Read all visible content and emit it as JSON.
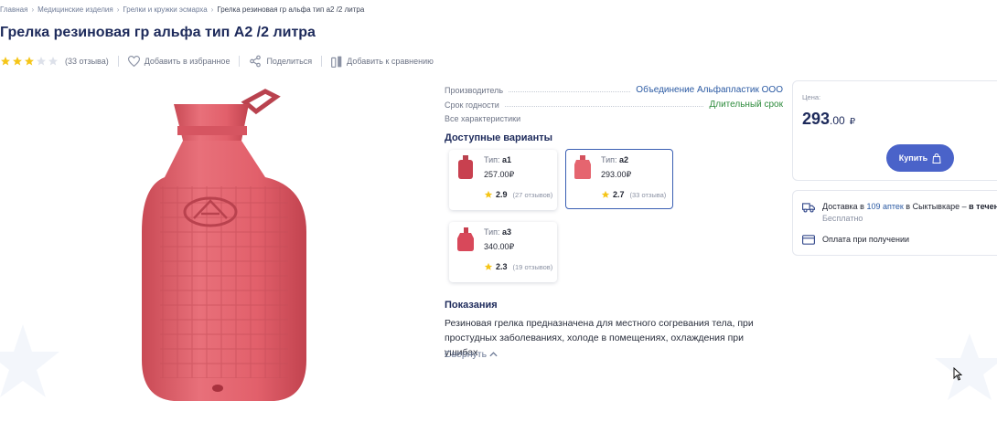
{
  "breadcrumb": {
    "items": [
      "Главная",
      "Медицинские изделия",
      "Грелки и кружки эсмарха"
    ],
    "current": "Грелка резиновая гр альфа тип а2 /2 литра"
  },
  "product": {
    "title": "Грелка резиновая гр альфа тип А2 /2 литра",
    "rating_stars": 3,
    "reviews_count": "(33 отзыва)",
    "favorite_label": "Добавить в избранное",
    "share_label": "Поделиться",
    "compare_label": "Добавить к сравнению",
    "image_icon": "hot-water-bottle-image"
  },
  "specs": [
    {
      "label": "Производитель",
      "value": "Объединение Альфапластик ООО",
      "color": "#2b5aa3"
    },
    {
      "label": "Срок годности",
      "value": "Длительный срок",
      "color": "#2d8b3c"
    }
  ],
  "all_specs_label": "Все характеристики",
  "variants": {
    "title": "Доступные варианты",
    "type_prefix": "Тип:",
    "items": [
      {
        "type": "а1",
        "price": "257.00₽",
        "rating": "2.9",
        "reviews": "(27 отзывов)",
        "active": false
      },
      {
        "type": "а2",
        "price": "293.00₽",
        "rating": "2.7",
        "reviews": "(33 отзыва)",
        "active": true
      },
      {
        "type": "а3",
        "price": "340.00₽",
        "rating": "2.3",
        "reviews": "(19 отзывов)",
        "active": false
      }
    ]
  },
  "indications": {
    "title": "Показания",
    "text": "Резиновая грелка предназначена для местного согревания тела, при простудных заболеваниях, холоде в помещениях, охлаждения при ушибах",
    "collapse_label": "Свернуть"
  },
  "price_box": {
    "label": "Цена:",
    "whole": "293",
    "cents": ".00",
    "currency": "₽",
    "buy_label": "Купить"
  },
  "delivery": {
    "prefix": "Доставка в ",
    "link": "109 аптек",
    "middle": " в Сыктывкаре – ",
    "bold": "в течени",
    "sub": "Бесплатно",
    "payment": "Оплата при получении"
  },
  "colors": {
    "accent": "#4a63c9",
    "title": "#1d2a5b",
    "link": "#2b5aa3",
    "star": "#f5c518",
    "product": "#e05a66"
  }
}
